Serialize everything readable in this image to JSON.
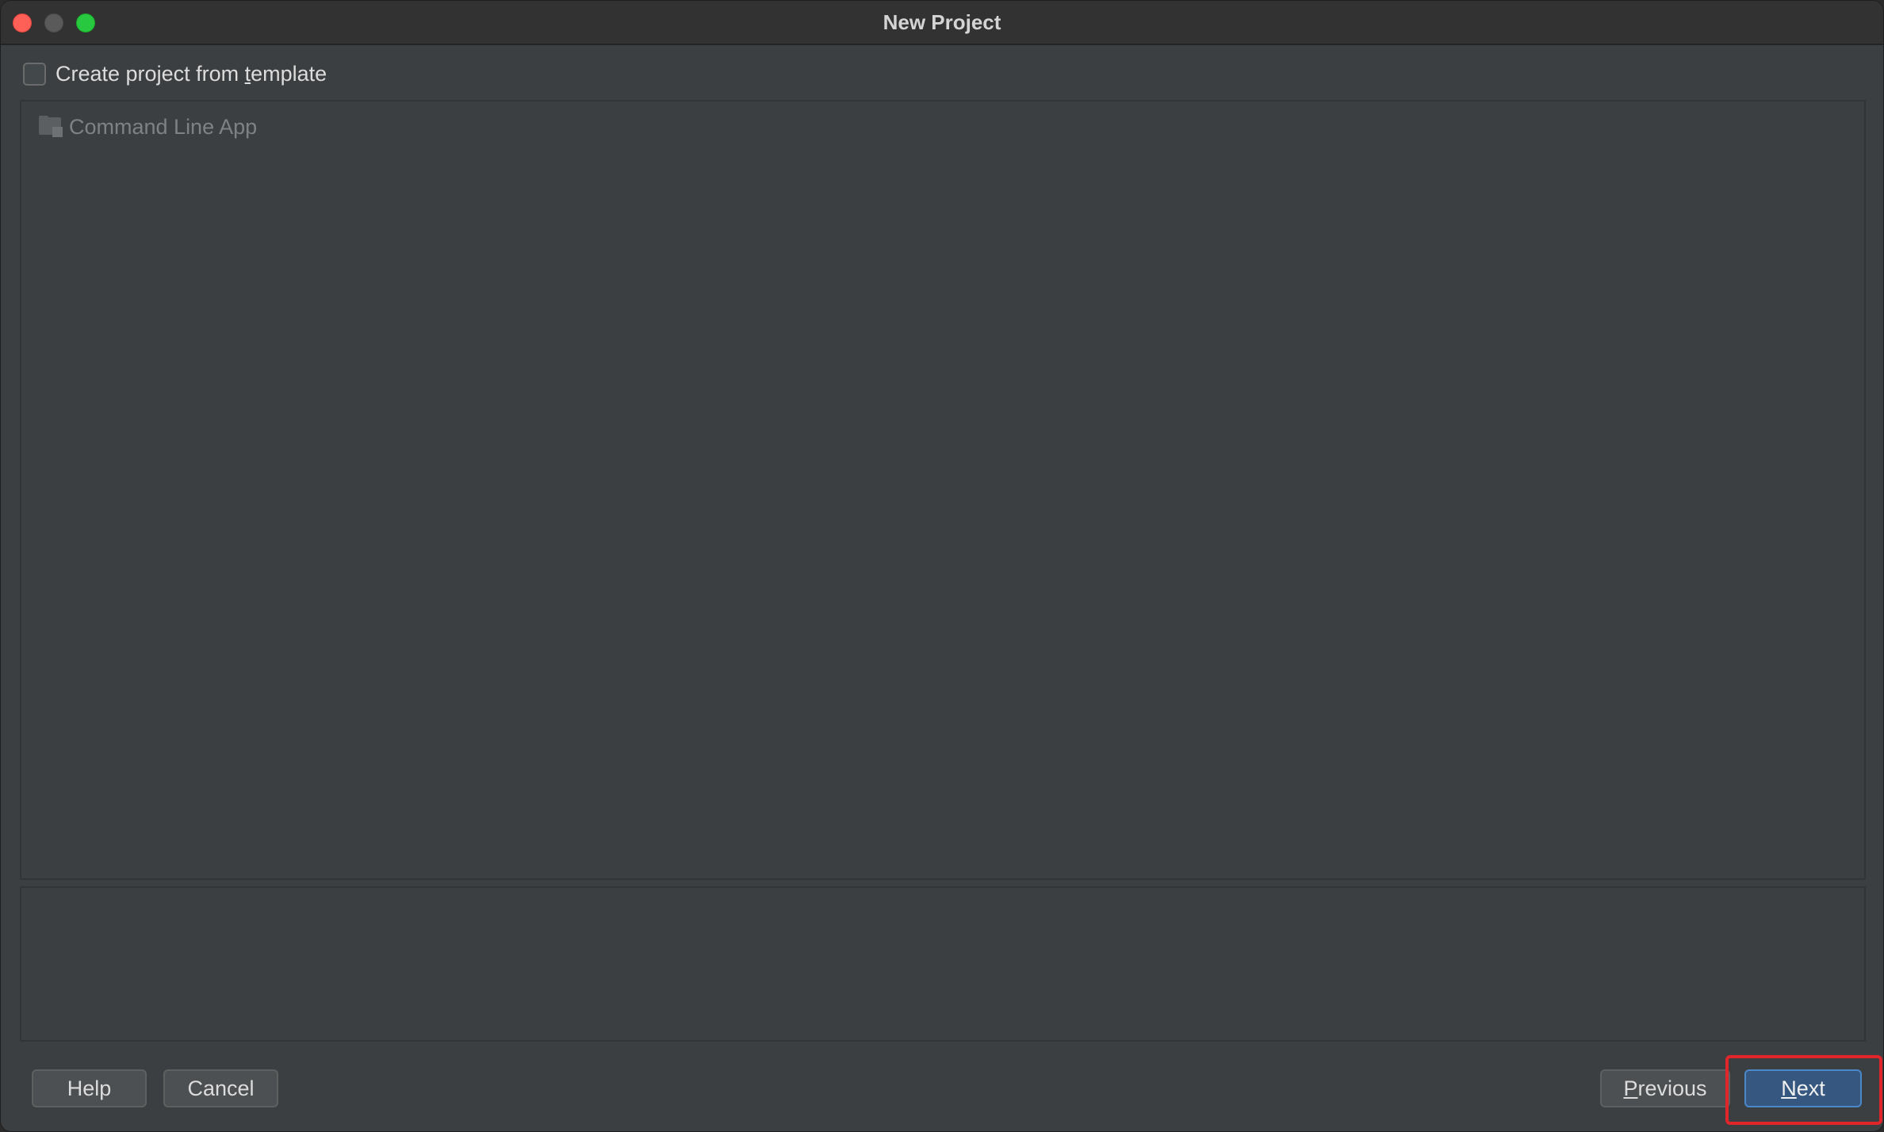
{
  "window": {
    "title": "New Project"
  },
  "template_option": {
    "label_pre": "Create project from ",
    "label_underlined": "t",
    "label_post": "emplate",
    "checked": false
  },
  "template_list": {
    "items": [
      {
        "label": "Command Line App",
        "icon": "folder-icon"
      }
    ]
  },
  "buttons": {
    "help": "Help",
    "cancel": "Cancel",
    "previous_underlined": "P",
    "previous_rest": "revious",
    "next_underlined": "N",
    "next_rest": "ext"
  },
  "colors": {
    "window_bg": "#3c3f41",
    "titlebar_bg": "#323232",
    "next_button_bg": "#365880",
    "highlight": "#e0262a"
  }
}
